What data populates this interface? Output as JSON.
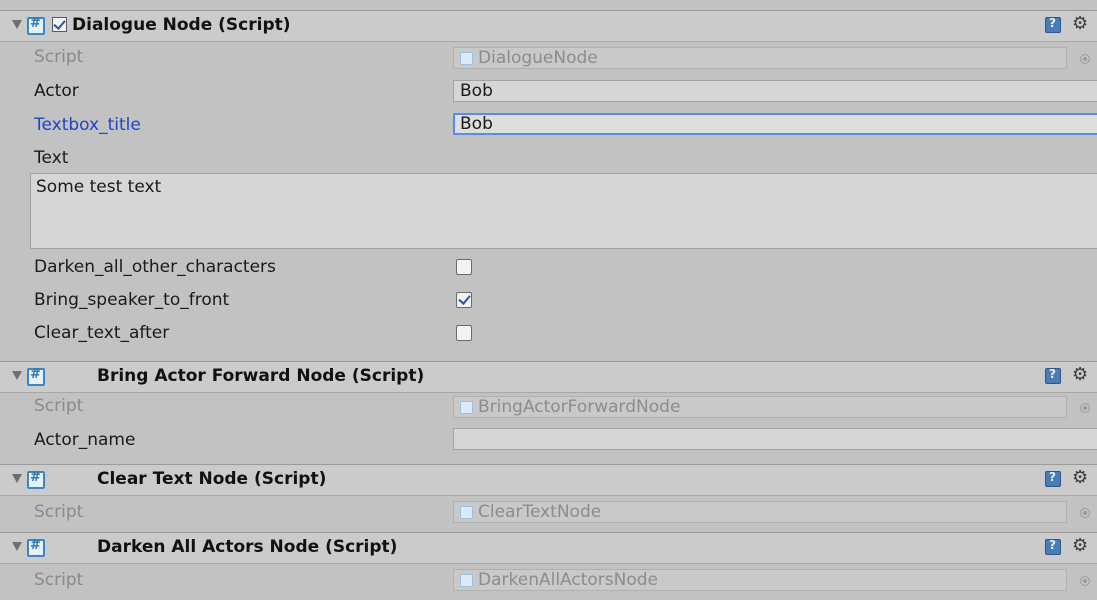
{
  "components": [
    {
      "title": "Dialogue Node (Script)",
      "script_label": "Script",
      "script_value": "DialogueNode",
      "fields": {
        "actor_label": "Actor",
        "actor_value": "Bob",
        "textbox_title_label": "Textbox_title",
        "textbox_title_value": "Bob",
        "text_label": "Text",
        "text_value": "Some test text",
        "darken_label": "Darken_all_other_characters",
        "darken_checked": false,
        "bring_label": "Bring_speaker_to_front",
        "bring_checked": true,
        "clear_label": "Clear_text_after",
        "clear_checked": false
      }
    },
    {
      "title": "Bring Actor Forward Node (Script)",
      "script_label": "Script",
      "script_value": "BringActorForwardNode",
      "fields": {
        "actor_name_label": "Actor_name",
        "actor_name_value": ""
      }
    },
    {
      "title": "Clear Text Node (Script)",
      "script_label": "Script",
      "script_value": "ClearTextNode"
    },
    {
      "title": "Darken All Actors Node (Script)",
      "script_label": "Script",
      "script_value": "DarkenAllActorsNode"
    }
  ],
  "gear_glyph": "⚙",
  "colors": {
    "focus_label": "#1c45c7",
    "focus_border": "#5b8ae8",
    "check_mark": "#2458a8"
  }
}
